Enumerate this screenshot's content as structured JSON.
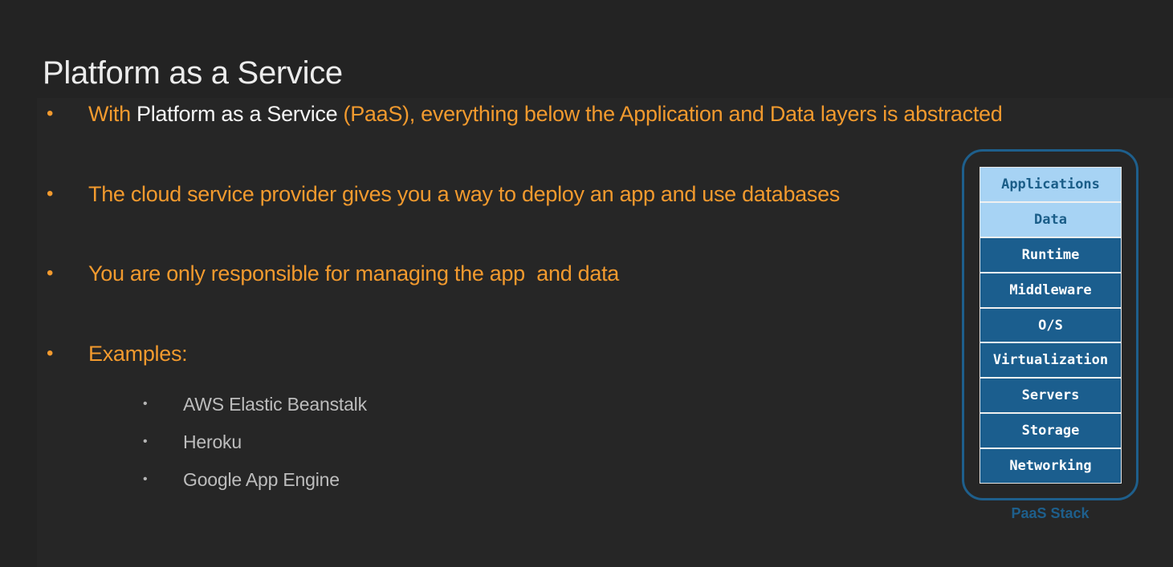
{
  "slide": {
    "title": "Platform as a Service"
  },
  "bullets": [
    {
      "marker": "•",
      "pre": "With ",
      "highlight": "Platform as a Service",
      "post": " (PaaS), everything below the Application and Data layers is abstracted"
    },
    {
      "marker": "•",
      "text": "The cloud service provider gives you a way to deploy an app and use databases"
    },
    {
      "marker": "•",
      "text": "You are only responsible for managing the app  and data"
    },
    {
      "marker": "•",
      "text": "Examples:"
    }
  ],
  "examples": [
    {
      "marker": "•",
      "text": "AWS Elastic Beanstalk"
    },
    {
      "marker": "•",
      "text": "Heroku"
    },
    {
      "marker": "•",
      "text": "Google App Engine"
    }
  ],
  "stack": {
    "caption": "PaaS Stack",
    "layers": [
      {
        "label": "Applications",
        "managed_by": "user"
      },
      {
        "label": "Data",
        "managed_by": "user"
      },
      {
        "label": "Runtime",
        "managed_by": "provider"
      },
      {
        "label": "Middleware",
        "managed_by": "provider"
      },
      {
        "label": "O/S",
        "managed_by": "provider"
      },
      {
        "label": "Virtualization",
        "managed_by": "provider"
      },
      {
        "label": "Servers",
        "managed_by": "provider"
      },
      {
        "label": "Storage",
        "managed_by": "provider"
      },
      {
        "label": "Networking",
        "managed_by": "provider"
      }
    ]
  },
  "colors": {
    "background": "#232323",
    "accent_orange": "#f29a2e",
    "highlight_white": "#f5f5f5",
    "sub_text_gray": "#bdbdbd",
    "stack_dark_blue": "#1b5e8e",
    "stack_light_blue": "#a7d3f4"
  }
}
